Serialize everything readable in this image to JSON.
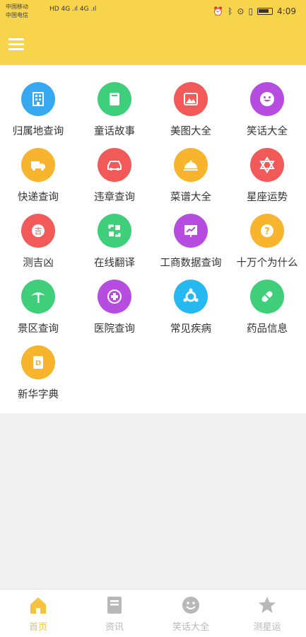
{
  "status_bar": {
    "carrier_1": "中国移动",
    "carrier_2": "中国电信",
    "signal_text": "HD 4G .ıl 4G .ıl",
    "time": "4:09"
  },
  "colors": {
    "accent": "#f8d44c",
    "nav_active": "#f5c242",
    "nav_inactive": "#b8b8b8"
  },
  "grid": [
    {
      "label": "归属地查询",
      "icon": "building-grid-icon",
      "color": "#36a9f0"
    },
    {
      "label": "童话故事",
      "icon": "book-icon",
      "color": "#3fcf7a"
    },
    {
      "label": "美图大全",
      "icon": "picture-icon",
      "color": "#f25a5a"
    },
    {
      "label": "笑话大全",
      "icon": "smiley-icon",
      "color": "#b64de0"
    },
    {
      "label": "快递查询",
      "icon": "truck-icon",
      "color": "#f7b42c"
    },
    {
      "label": "违章查询",
      "icon": "car-icon",
      "color": "#f25a5a"
    },
    {
      "label": "菜谱大全",
      "icon": "food-cloche-icon",
      "color": "#f7b42c"
    },
    {
      "label": "星座运势",
      "icon": "star-of-david-icon",
      "color": "#f25a5a"
    },
    {
      "label": "测吉凶",
      "icon": "fortune-coin-icon",
      "color": "#f25a5a"
    },
    {
      "label": "在线翻译",
      "icon": "translate-arrows-icon",
      "color": "#3fcf7a"
    },
    {
      "label": "工商数据查询",
      "icon": "chart-board-icon",
      "color": "#b64de0"
    },
    {
      "label": "十万个为什么",
      "icon": "question-icon",
      "color": "#f7b42c"
    },
    {
      "label": "景区查询",
      "icon": "palm-tree-icon",
      "color": "#3fcf7a"
    },
    {
      "label": "医院查询",
      "icon": "medical-cross-icon",
      "color": "#b64de0"
    },
    {
      "label": "常见疾病",
      "icon": "virus-icon",
      "color": "#26b8f0"
    },
    {
      "label": "药品信息",
      "icon": "pill-icon",
      "color": "#3fcf7a"
    },
    {
      "label": "新华字典",
      "icon": "dictionary-icon",
      "color": "#f7b42c"
    }
  ],
  "bottom_nav": [
    {
      "label": "首页",
      "icon": "home-icon",
      "active": true
    },
    {
      "label": "资讯",
      "icon": "news-icon",
      "active": false
    },
    {
      "label": "笑话大全",
      "icon": "smiley-icon",
      "active": false
    },
    {
      "label": "测星运",
      "icon": "star-icon",
      "active": false
    }
  ]
}
